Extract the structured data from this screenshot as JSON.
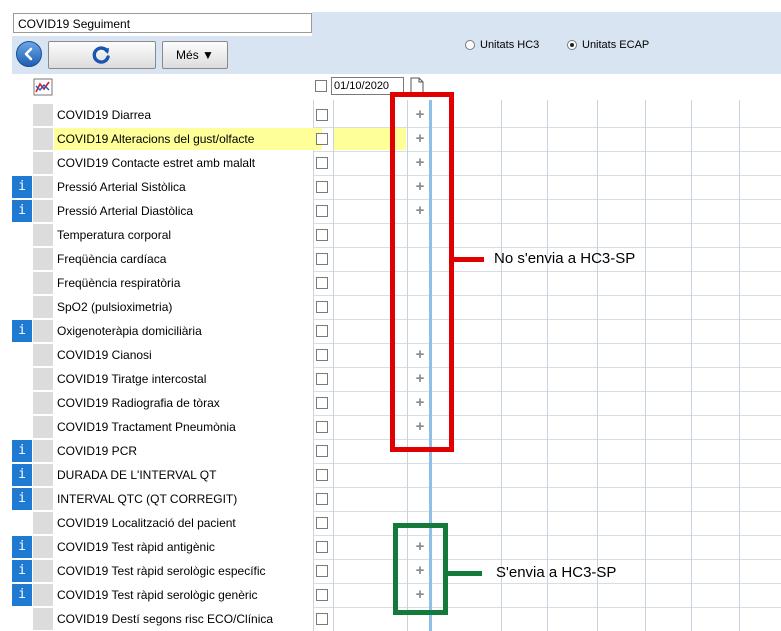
{
  "window": {
    "title": "COVID19 Seguiment"
  },
  "toolbar": {
    "back_icon": "back-arrow-icon",
    "refresh_icon": "refresh-icon",
    "more_label": "Més ▼"
  },
  "units": {
    "options": [
      {
        "label": "Unitats HC3",
        "selected": false
      },
      {
        "label": "Unitats ECAP",
        "selected": true
      }
    ]
  },
  "grid": {
    "date": "01/10/2020",
    "rows": [
      {
        "label": "COVID19 Diarrea",
        "info": false,
        "plus": true,
        "highlight": false
      },
      {
        "label": "COVID19 Alteracions del gust/olfacte",
        "info": false,
        "plus": true,
        "highlight": true
      },
      {
        "label": "COVID19 Contacte estret amb malalt",
        "info": false,
        "plus": true,
        "highlight": false
      },
      {
        "label": "Pressió Arterial Sistòlica",
        "info": true,
        "plus": true,
        "highlight": false
      },
      {
        "label": "Pressió Arterial Diastòlica",
        "info": true,
        "plus": true,
        "highlight": false
      },
      {
        "label": "Temperatura corporal",
        "info": false,
        "plus": false,
        "highlight": false
      },
      {
        "label": "Freqüència cardíaca",
        "info": false,
        "plus": false,
        "highlight": false
      },
      {
        "label": "Freqüència respiratòria",
        "info": false,
        "plus": false,
        "highlight": false
      },
      {
        "label": "SpO2 (pulsioximetria)",
        "info": false,
        "plus": false,
        "highlight": false
      },
      {
        "label": "Oxigenoteràpia domiciliària",
        "info": true,
        "plus": false,
        "highlight": false
      },
      {
        "label": "COVID19 Cianosi",
        "info": false,
        "plus": true,
        "highlight": false
      },
      {
        "label": "COVID19 Tiratge intercostal",
        "info": false,
        "plus": true,
        "highlight": false
      },
      {
        "label": "COVID19 Radiografia de tòrax",
        "info": false,
        "plus": true,
        "highlight": false
      },
      {
        "label": "COVID19 Tractament Pneumònia",
        "info": false,
        "plus": true,
        "highlight": false
      },
      {
        "label": "COVID19 PCR",
        "info": true,
        "plus": false,
        "highlight": false
      },
      {
        "label": "DURADA DE L'INTERVAL QT",
        "info": true,
        "plus": false,
        "highlight": false
      },
      {
        "label": "INTERVAL QTC (QT CORREGIT)",
        "info": true,
        "plus": false,
        "highlight": false
      },
      {
        "label": "COVID19 Localització del pacient",
        "info": false,
        "plus": false,
        "highlight": false
      },
      {
        "label": "COVID19 Test ràpid antigènic",
        "info": true,
        "plus": true,
        "highlight": false
      },
      {
        "label": "COVID19 Test ràpid serològic específic",
        "info": true,
        "plus": true,
        "highlight": false
      },
      {
        "label": "COVID19 Test ràpid serològic genèric",
        "info": true,
        "plus": true,
        "highlight": false
      },
      {
        "label": "COVID19 Destí segons risc ECO/Clínica",
        "info": false,
        "plus": false,
        "highlight": false
      }
    ],
    "info_glyph": "i",
    "plus_glyph": "+"
  },
  "annotations": {
    "red_text": "No s'envia a HC3-SP",
    "green_text": "S'envia a HC3-SP",
    "red_color": "#e00000",
    "green_color": "#137a3c"
  },
  "colors": {
    "header_band": "#d9e4f2",
    "highlight": "#ffff99",
    "info_blue": "#1f7ad1"
  }
}
